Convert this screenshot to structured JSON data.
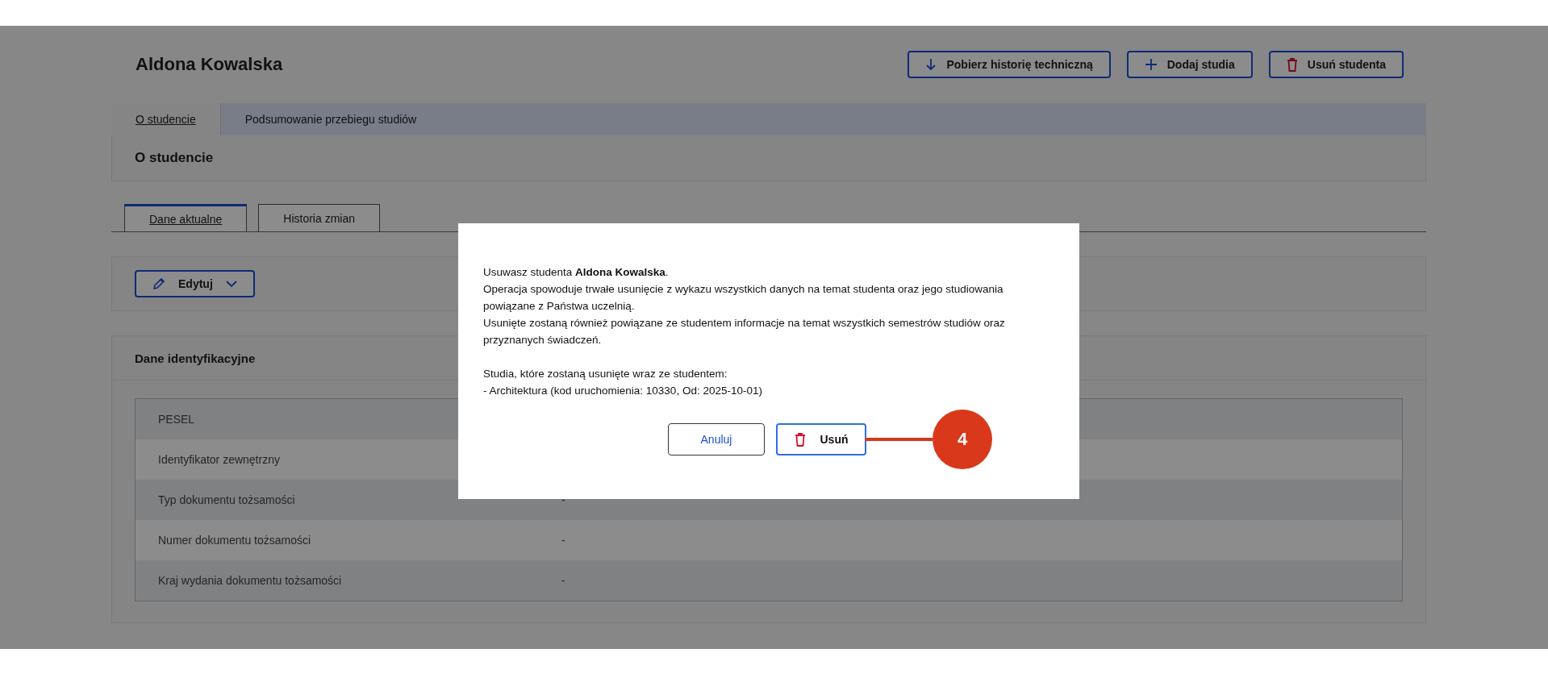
{
  "page": {
    "student_name": "Aldona Kowalska",
    "actions": [
      {
        "kind": "download",
        "label": "Pobierz historię techniczną"
      },
      {
        "kind": "add",
        "label": "Dodaj studia"
      },
      {
        "kind": "delete",
        "label": "Usuń studenta"
      }
    ]
  },
  "tabs": [
    {
      "label": "O studencie",
      "selected": true
    },
    {
      "label": "Podsumowanie przebiegu studiów",
      "selected": false
    }
  ],
  "section_title": "O studencie",
  "subtabs": [
    {
      "label": "Dane aktualne",
      "selected": true
    },
    {
      "label": "Historia zmian",
      "selected": false
    }
  ],
  "edit_button": {
    "label": "Edytuj"
  },
  "identification": {
    "title": "Dane identyfikacyjne",
    "rows": [
      {
        "label": "PESEL"
      },
      {
        "label": "Identyfikator zewnętrzny"
      },
      {
        "label": "Typ dokumentu tożsamości",
        "value": "-"
      },
      {
        "label": "Numer dokumentu tożsamości",
        "value": "-"
      },
      {
        "label": "Kraj wydania dokumentu tożsamości",
        "value": "-"
      }
    ]
  },
  "dialog": {
    "blocks": [
      [
        "Usuwasz studenta **Aldona Kowalska**.",
        "Operacja spowoduje trwałe usunięcie z wykazu wszystkich danych na temat studenta oraz jego studiowania powiązane z Państwa uczelnią.",
        "Usunięte zostaną również powiązane ze studentem informacje na temat wszystkich semestrów studiów oraz przyznanych świadczeń."
      ],
      [
        "Studia, które zostaną usunięte wraz ze studentem:",
        "- Architektura (kod uruchomienia: 10330, Od: 2025-10-01)"
      ]
    ],
    "buttons": [
      {
        "kind": "cancel",
        "label": "Anuluj"
      },
      {
        "kind": "delete",
        "label": "Usuń"
      }
    ]
  },
  "callout": {
    "label": "4"
  }
}
